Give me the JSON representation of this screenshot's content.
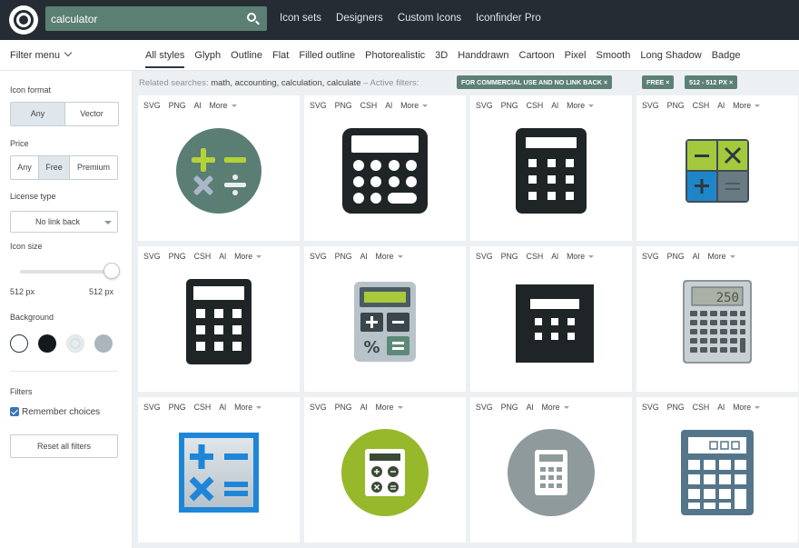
{
  "topbar": {
    "search_value": "calculator",
    "nav": [
      "Icon sets",
      "Designers",
      "Custom Icons",
      "Iconfinder Pro"
    ]
  },
  "filter_menu": "Filter menu",
  "style_tabs": [
    "All styles",
    "Glyph",
    "Outline",
    "Flat",
    "Filled outline",
    "Photorealistic",
    "3D",
    "Handdrawn",
    "Cartoon",
    "Pixel",
    "Smooth",
    "Long Shadow",
    "Badge"
  ],
  "sidebar": {
    "icon_format_label": "Icon format",
    "icon_format_options": [
      "Any",
      "Vector"
    ],
    "price_label": "Price",
    "price_options": [
      "Any",
      "Free",
      "Premium"
    ],
    "license_label": "License type",
    "license_value": "No link back",
    "size_label": "Icon size",
    "size_min": "512 px",
    "size_max": "512 px",
    "background_label": "Background",
    "filters_label": "Filters",
    "remember_label": "Remember choices",
    "reset_label": "Reset all filters"
  },
  "related": {
    "prefix": "Related searches:",
    "keywords": "math, accounting, calculation, calculate",
    "suffix": "– Active filters:",
    "tags": [
      "FOR COMMERCIAL USE AND NO LINK BACK ×",
      "FREE ×",
      "512 - 512 PX ×"
    ]
  },
  "cards": [
    {
      "formats": [
        "SVG",
        "PNG",
        "Al",
        "More"
      ],
      "icon": "math-operators-circle-icon"
    },
    {
      "formats": [
        "SVG",
        "PNG",
        "CSH",
        "Al",
        "More"
      ],
      "icon": "calculator-glyph-icon"
    },
    {
      "formats": [
        "SVG",
        "PNG",
        "CSH",
        "Al",
        "More"
      ],
      "icon": "calculator-square-glyph-icon"
    },
    {
      "formats": [
        "SVG",
        "PNG",
        "CSH",
        "Al",
        "More"
      ],
      "icon": "calculator-colored-tiles-icon"
    },
    {
      "formats": [
        "SVG",
        "PNG",
        "CSH",
        "Al",
        "More"
      ],
      "icon": "calculator-outline-icon"
    },
    {
      "formats": [
        "SVG",
        "PNG",
        "Al",
        "More"
      ],
      "icon": "calculator-flat-icon"
    },
    {
      "formats": [
        "SVG",
        "PNG",
        "CSH",
        "Al",
        "More"
      ],
      "icon": "calculator-box-icon"
    },
    {
      "formats": [
        "SVG",
        "PNG",
        "Al",
        "More"
      ],
      "icon": "calculator-photorealistic-icon"
    },
    {
      "formats": [
        "SVG",
        "PNG",
        "CSH",
        "Al",
        "More"
      ],
      "icon": "math-operators-square-icon"
    },
    {
      "formats": [
        "SVG",
        "PNG",
        "Al",
        "More"
      ],
      "icon": "calculator-green-circle-icon"
    },
    {
      "formats": [
        "SVG",
        "PNG",
        "Al",
        "More"
      ],
      "icon": "calculator-gray-circle-icon"
    },
    {
      "formats": [
        "SVG",
        "PNG",
        "CSH",
        "Al",
        "More"
      ],
      "icon": "calculator-blue-gray-icon"
    }
  ],
  "colors": {
    "topbar": "#252c33",
    "search_bg": "#5c7f73",
    "tag_bg": "#5d8076",
    "checkbox": "#3d74b8"
  }
}
